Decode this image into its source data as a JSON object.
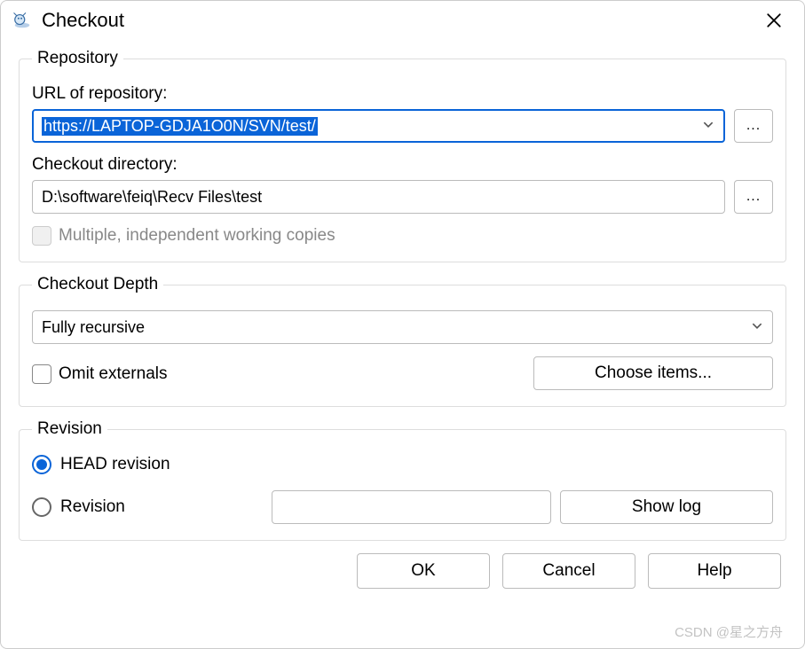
{
  "window": {
    "title": "Checkout"
  },
  "repository": {
    "legend": "Repository",
    "url_label": "URL of repository:",
    "url_value": "https://LAPTOP-GDJA1O0N/SVN/test/",
    "browse_url_label": "...",
    "dir_label": "Checkout directory:",
    "dir_value": "D:\\software\\feiq\\Recv Files\\test",
    "browse_dir_label": "...",
    "multiple_label": "Multiple, independent working copies",
    "multiple_checked": false,
    "multiple_enabled": false
  },
  "depth": {
    "legend": "Checkout Depth",
    "value": "Fully recursive",
    "omit_label": "Omit externals",
    "omit_checked": false,
    "choose_items_label": "Choose items..."
  },
  "revision": {
    "legend": "Revision",
    "head_label": "HEAD revision",
    "rev_label": "Revision",
    "selected": "head",
    "rev_value": "",
    "show_log_label": "Show log"
  },
  "footer": {
    "ok": "OK",
    "cancel": "Cancel",
    "help": "Help"
  },
  "watermark": "CSDN @星之方舟"
}
